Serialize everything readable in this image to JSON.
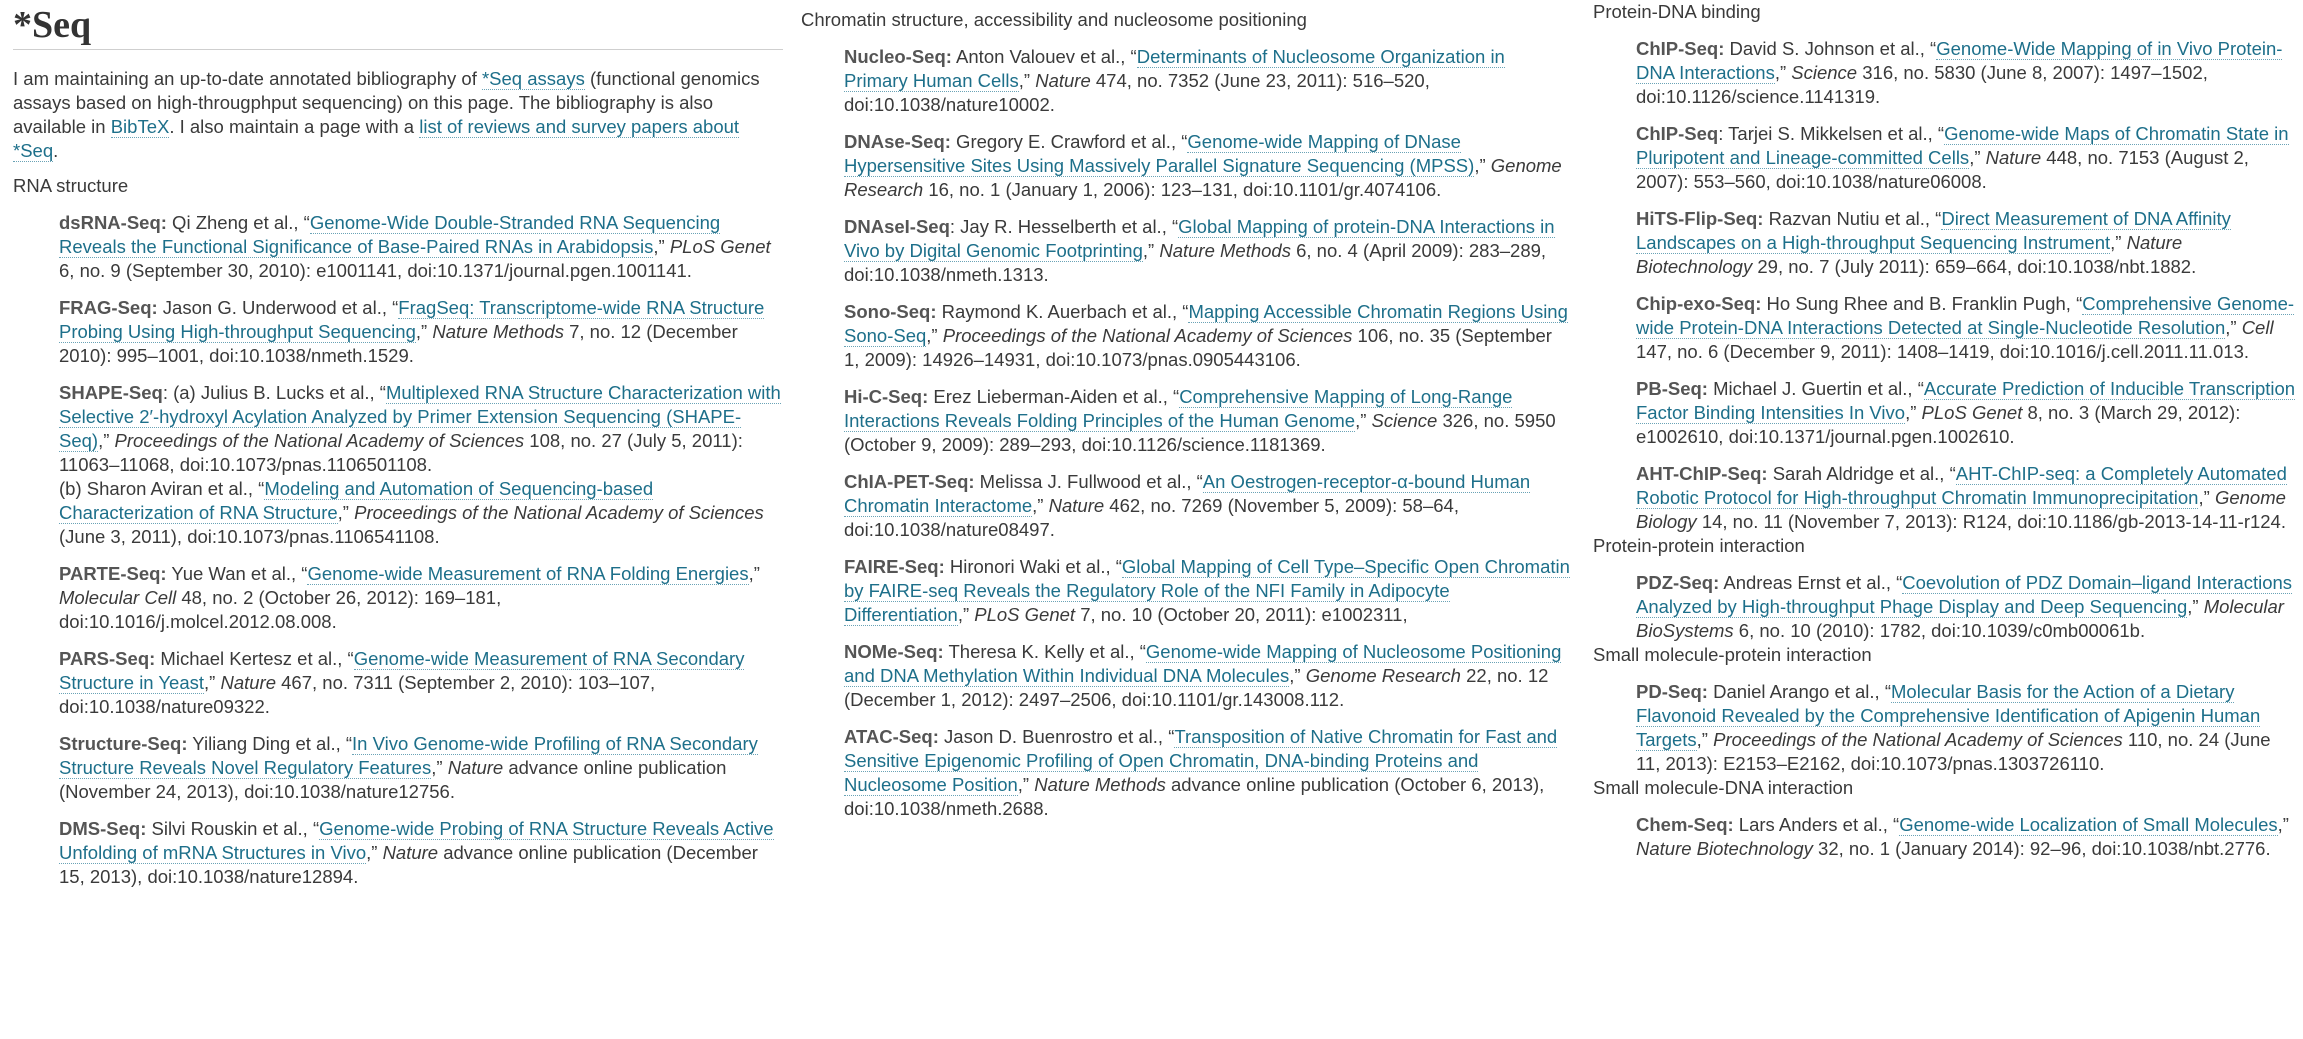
{
  "page": {
    "title": "*Seq",
    "intro": {
      "t1": "I am maintaining an up-to-date annotated bibliography of ",
      "link1": "*Seq assays",
      "t2": " (functional genomics assays based on high-througphput sequencing) on this page. The bibliography is also available in ",
      "link2": "BibTeX",
      "t3": ". I also maintain a page with a ",
      "link3": "list of reviews and survey papers about *Seq",
      "t4": "."
    }
  },
  "columns": [
    {
      "sections": [
        {
          "heading": "RNA structure",
          "entries": [
            {
              "name": "dsRNA-Seq:",
              "authors": " Qi Zheng et al., “",
              "link": "Genome-Wide Double-Stranded RNA Sequencing Reveals the Functional Significance of Base-Paired RNAs in Arabidopsis",
              "mid": ",” ",
              "journal": "PLoS Genet",
              "rest": " 6, no. 9 (September 30, 2010): e1001141, doi:10.1371/journal.pgen.1001141."
            },
            {
              "name": "FRAG-Seq:",
              "authors": " Jason G. Underwood et al., “",
              "link": "FragSeq: Transcriptome-wide RNA Structure Probing Using High-throughput Sequencing",
              "mid": ",” ",
              "journal": "Nature Methods",
              "rest": " 7, no. 12 (December 2010): 995–1001, doi:10.1038/nmeth.1529."
            },
            {
              "name": "SHAPE-Seq",
              "authors": ": (a) Julius B. Lucks et al., “",
              "link": "Multiplexed RNA Structure Characterization with Selective 2′-hydroxyl Acylation Analyzed by Primer Extension Sequencing (SHAPE-Seq)",
              "mid": ",” ",
              "journal": "Proceedings of the National Academy of Sciences",
              "rest": " 108, no. 27 (July 5, 2011): 11063–11068, doi:10.1073/pnas.1106501108.",
              "sub": {
                "authors": "(b) Sharon Aviran et al., “",
                "link": "Modeling and Automation of Sequencing-based Characterization of RNA Structure",
                "mid": ",” ",
                "journal": "Proceedings of the National Academy of Sciences",
                "rest": " (June 3, 2011), doi:10.1073/pnas.1106541108."
              }
            },
            {
              "name": "PARTE-Seq:",
              "authors": " Yue Wan et al., “",
              "link": "Genome-wide Measurement of RNA Folding Energies",
              "mid": ",” ",
              "journal": "Molecular Cell",
              "rest": " 48, no. 2 (October 26, 2012): 169–181, doi:10.1016/j.molcel.2012.08.008."
            },
            {
              "name": "PARS-Seq:",
              "authors": " Michael Kertesz et al., “",
              "link": "Genome-wide Measurement of RNA Secondary Structure in Yeast",
              "mid": ",” ",
              "journal": "Nature",
              "rest": " 467, no. 7311 (September 2, 2010): 103–107, doi:10.1038/nature09322."
            },
            {
              "name": "Structure-Seq:",
              "authors": " Yiliang Ding et al., “",
              "link": "In Vivo Genome-wide Profiling of RNA Secondary Structure Reveals Novel Regulatory Features",
              "mid": ",” ",
              "journal": "Nature",
              "rest": " advance online publication (November 24, 2013), doi:10.1038/nature12756."
            },
            {
              "name": "DMS-Seq:",
              "authors": " Silvi Rouskin et al., “",
              "link": "Genome-wide Probing of RNA Structure Reveals Active Unfolding of mRNA Structures in Vivo",
              "mid": ",” ",
              "journal": "Nature",
              "rest": " advance online publication (December 15, 2013), doi:10.1038/nature12894."
            }
          ]
        }
      ]
    },
    {
      "sections": [
        {
          "heading": "Chromatin structure, accessibility and nucleosome positioning",
          "entries": [
            {
              "name": "Nucleo-Seq:",
              "authors": " Anton Valouev et al., “",
              "link": "Determinants of Nucleosome Organization in Primary Human Cells",
              "mid": ",” ",
              "journal": "Nature",
              "rest": " 474, no. 7352 (June 23, 2011): 516–520, doi:10.1038/nature10002."
            },
            {
              "name": "DNAse-Seq:",
              "authors": " Gregory E. Crawford et al., “",
              "link": "Genome-wide Mapping of DNase Hypersensitive Sites Using Massively Parallel Signature Sequencing (MPSS)",
              "mid": ",” ",
              "journal": "Genome Research",
              "rest": " 16, no. 1 (January 1, 2006): 123–131, doi:10.1101/gr.4074106."
            },
            {
              "name": "DNAseI-Seq",
              "authors": ": Jay R. Hesselberth et al., “",
              "link": "Global Mapping of protein-DNA Interactions in Vivo by Digital Genomic Footprinting",
              "mid": ",” ",
              "journal": "Nature Methods",
              "rest": " 6, no. 4 (April 2009): 283–289, doi:10.1038/nmeth.1313."
            },
            {
              "name": "Sono-Seq:",
              "authors": " Raymond K. Auerbach et al., “",
              "link": "Mapping Accessible Chromatin Regions Using Sono-Seq",
              "mid": ",” ",
              "journal": "Proceedings of the National Academy of Sciences",
              "rest": " 106, no. 35 (September 1, 2009): 14926–14931, doi:10.1073/pnas.0905443106."
            },
            {
              "name": "Hi-C-Seq:",
              "authors": " Erez Lieberman-Aiden et al., “",
              "link": "Comprehensive Mapping of Long-Range Interactions Reveals Folding Principles of the Human Genome",
              "mid": ",” ",
              "journal": "Science",
              "rest": " 326, no. 5950 (October 9, 2009): 289–293, doi:10.1126/science.1181369."
            },
            {
              "name": "ChIA-PET-Seq:",
              "authors": " Melissa J. Fullwood et al., “",
              "link": "An Oestrogen-receptor-α-bound Human Chromatin Interactome",
              "mid": ",” ",
              "journal": "Nature",
              "rest": " 462, no. 7269 (November 5, 2009): 58–64, doi:10.1038/nature08497."
            },
            {
              "name": "FAIRE-Seq:",
              "authors": " Hironori Waki et al., “",
              "link": "Global Mapping of Cell Type–Specific Open Chromatin by FAIRE-seq Reveals the Regulatory Role of the NFI Family in Adipocyte Differentiation",
              "mid": ",” ",
              "journal": "PLoS Genet",
              "rest": " 7, no. 10 (October 20, 2011): e1002311,"
            },
            {
              "name": "NOMe-Seq:",
              "authors": " Theresa K. Kelly et al., “",
              "link": "Genome-wide Mapping of Nucleosome Positioning and DNA Methylation Within Individual DNA Molecules",
              "mid": ",” ",
              "journal": "Genome Research",
              "rest": " 22, no. 12 (December 1, 2012): 2497–2506, doi:10.1101/gr.143008.112."
            },
            {
              "name": "ATAC-Seq:",
              "authors": " Jason D. Buenrostro et al., “",
              "link": "Transposition of Native Chromatin for Fast and Sensitive Epigenomic Profiling of Open Chromatin, DNA-binding Proteins and Nucleosome Position",
              "mid": ",” ",
              "journal": "Nature Methods",
              "rest": " advance online publication (October 6, 2013), doi:10.1038/nmeth.2688."
            }
          ]
        }
      ]
    },
    {
      "sections": [
        {
          "heading": "Protein-DNA binding",
          "entries": [
            {
              "name": "ChIP-Seq:",
              "authors": " David S. Johnson et al., “",
              "link": "Genome-Wide Mapping of in Vivo Protein-DNA Interactions",
              "mid": ",” ",
              "journal": "Science",
              "rest": " 316, no. 5830 (June 8, 2007): 1497–1502, doi:10.1126/science.1141319."
            },
            {
              "name": "ChIP-Seq",
              "authors": ": Tarjei S. Mikkelsen et al., “",
              "link": "Genome-wide Maps of Chromatin State in Pluripotent and Lineage-committed Cells",
              "mid": ",” ",
              "journal": "Nature",
              "rest": " 448, no. 7153 (August 2, 2007): 553–560, doi:10.1038/nature06008."
            },
            {
              "name": "HiTS-Flip-Seq:",
              "authors": " Razvan Nutiu et al., “",
              "link": "Direct Measurement of DNA Affinity Landscapes on a High-throughput Sequencing Instrument",
              "mid": ",” ",
              "journal": "Nature Biotechnology",
              "rest": " 29, no. 7 (July 2011): 659–664, doi:10.1038/nbt.1882."
            },
            {
              "name": "Chip-exo-Seq:",
              "authors": " Ho Sung Rhee and B. Franklin Pugh, “",
              "link": "Comprehensive Genome-wide Protein-DNA Interactions Detected at Single-Nucleotide Resolution",
              "mid": ",” ",
              "journal": "Cell",
              "rest": " 147, no. 6 (December 9, 2011): 1408–1419, doi:10.1016/j.cell.2011.11.013."
            },
            {
              "name": "PB-Seq:",
              "authors": " Michael J. Guertin et al., “",
              "link": "Accurate Prediction of Inducible Transcription Factor Binding Intensities In Vivo",
              "mid": ",” ",
              "journal": "PLoS Genet",
              "rest": " 8, no. 3 (March 29, 2012): e1002610, doi:10.1371/journal.pgen.1002610."
            },
            {
              "name": "AHT-ChIP-Seq:",
              "authors": " Sarah Aldridge et al., “",
              "link": "AHT-ChIP-seq: a Completely Automated Robotic Protocol for High-throughput Chromatin Immunoprecipitation",
              "mid": ",” ",
              "journal": "Genome Biology",
              "rest": " 14, no. 11 (November 7, 2013): R124, doi:10.1186/gb-2013-14-11-r124."
            }
          ]
        },
        {
          "heading": "Protein-protein interaction",
          "entries": [
            {
              "name": "PDZ-Seq:",
              "authors": " Andreas Ernst et al., “",
              "link": "Coevolution of PDZ Domain–ligand Interactions Analyzed by High-throughput Phage Display and Deep Sequencing",
              "mid": ",” ",
              "journal": "Molecular BioSystems",
              "rest": " 6, no. 10 (2010): 1782, doi:10.1039/c0mb00061b."
            }
          ]
        },
        {
          "heading": "Small molecule-protein interaction",
          "entries": [
            {
              "name": "PD-Seq:",
              "authors": " Daniel Arango et al., “",
              "link": "Molecular Basis for the Action of a Dietary Flavonoid Revealed by the Comprehensive Identification of Apigenin Human Targets",
              "mid": ",” ",
              "journal": "Proceedings of the National Academy of Sciences",
              "rest": " 110, no. 24 (June 11, 2013): E2153–E2162, doi:10.1073/pnas.1303726110."
            }
          ]
        },
        {
          "heading": "Small molecule-DNA interaction",
          "entries": [
            {
              "name": "Chem-Seq:",
              "authors": " Lars Anders et al., “",
              "link": "Genome-wide Localization of Small Molecules",
              "mid": ",” ",
              "journal": "Nature Biotechnology",
              "rest": " 32, no. 1 (January 2014): 92–96, doi:10.1038/nbt.2776."
            }
          ]
        }
      ]
    }
  ]
}
